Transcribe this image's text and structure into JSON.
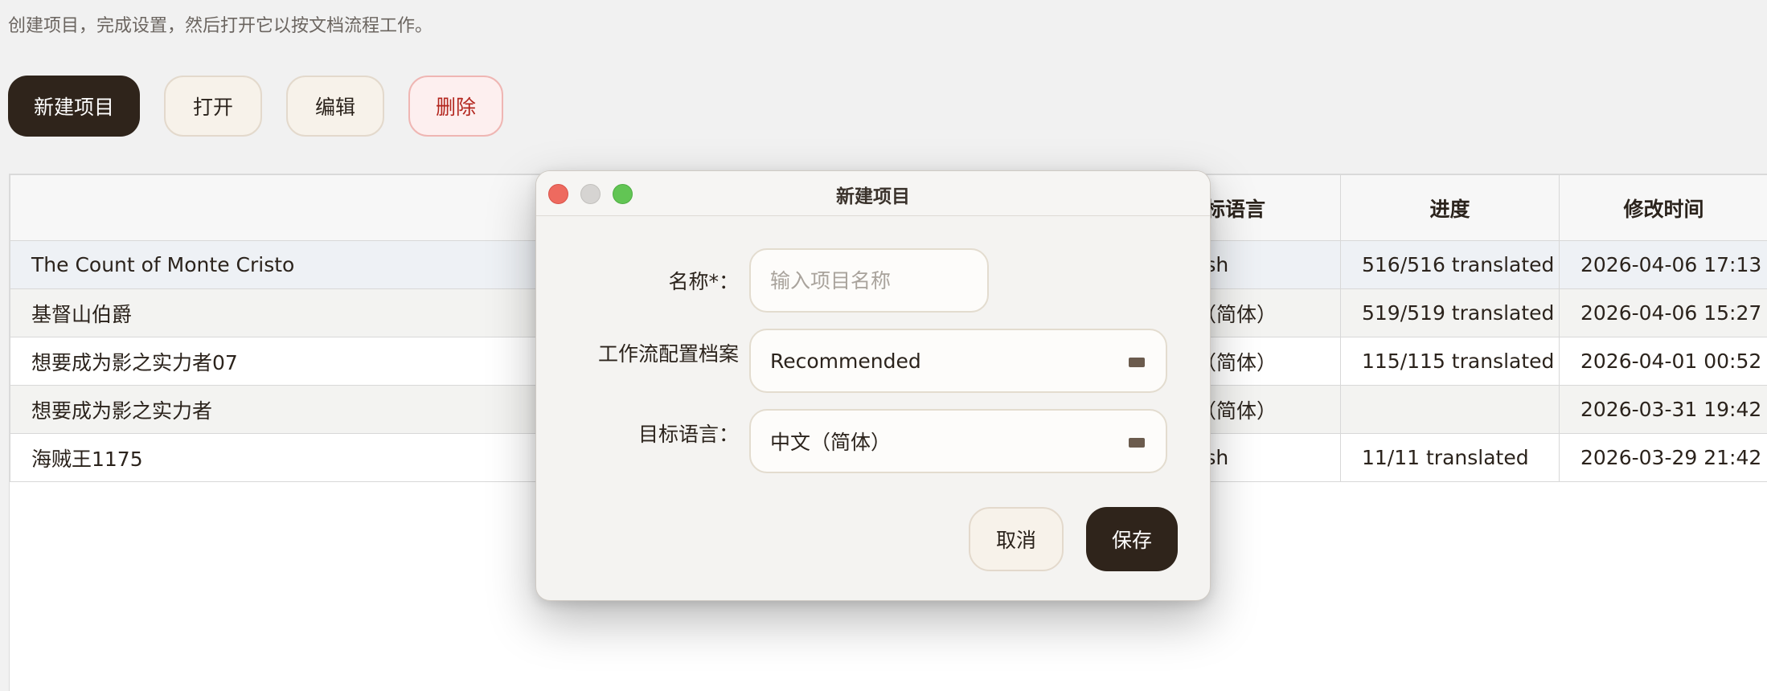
{
  "subtitle": "创建项目，完成设置，然后打开它以按文档流程工作。",
  "toolbar": {
    "new_label": "新建项目",
    "open_label": "打开",
    "edit_label": "编辑",
    "delete_label": "删除"
  },
  "table": {
    "columns": [
      "",
      "",
      "目标语言",
      "进度",
      "修改时间"
    ],
    "rows": [
      {
        "name": "The Count of Monte Cristo",
        "target": "English",
        "progress": "516/516 translated",
        "modified": "2026-04-06 17:13"
      },
      {
        "name": "基督山伯爵",
        "target": "中文（简体）",
        "progress": "519/519 translated",
        "modified": "2026-04-06 15:27"
      },
      {
        "name": "想要成为影之实力者07",
        "target": "中文（简体）",
        "progress": "115/115 translated",
        "modified": "2026-04-01 00:52"
      },
      {
        "name": "想要成为影之实力者",
        "target": "中文（简体）",
        "progress": "",
        "modified": "2026-03-31 19:42"
      },
      {
        "name": "海贼王1175",
        "target": "English",
        "progress": "11/11 translated",
        "modified": "2026-03-29 21:42"
      }
    ]
  },
  "dialog": {
    "title": "新建项目",
    "name_label": "名称*：",
    "name_placeholder": "输入项目名称",
    "name_value": "",
    "profile_label": "工作流配置档案",
    "profile_value": "Recommended",
    "target_label": "目标语言：",
    "target_value": "中文（简体）",
    "cancel_label": "取消",
    "save_label": "保存"
  },
  "colors": {
    "primary_dark": "#2f241b",
    "danger_text": "#b3261e",
    "selected_row": "#eef1f5",
    "close_dot": "#ee6a5f",
    "minimize_dot": "#d6d4d2",
    "zoom_dot": "#62c554"
  }
}
